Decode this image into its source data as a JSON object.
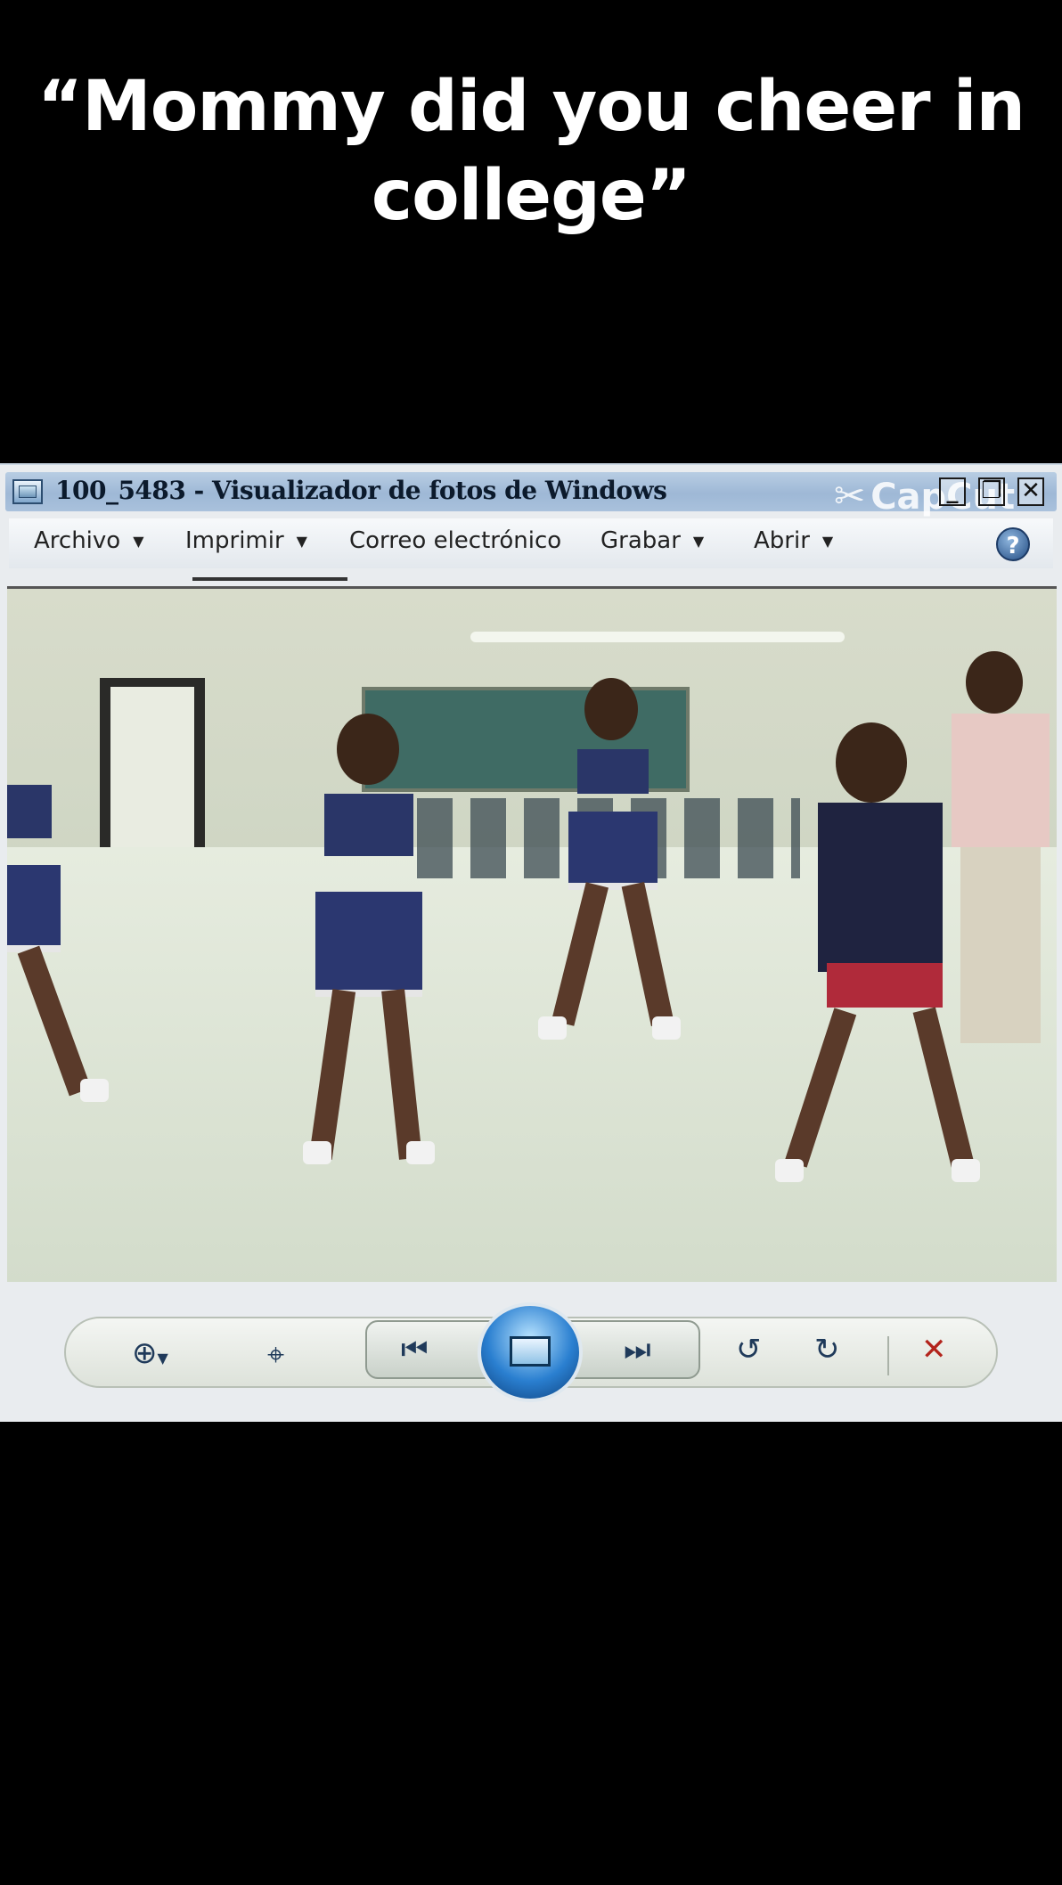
{
  "caption": {
    "line1": "“Mommy did you cheer in",
    "line2": "college”"
  },
  "window": {
    "title": "100_5483 - Visualizador de fotos de Windows",
    "watermark": "CapCut",
    "menu": [
      {
        "label": "Archivo",
        "has_dropdown": true
      },
      {
        "label": "Imprimir",
        "has_dropdown": true
      },
      {
        "label": "Correo electrónico",
        "has_dropdown": false
      },
      {
        "label": "Grabar",
        "has_dropdown": true
      },
      {
        "label": "Abrir",
        "has_dropdown": true
      }
    ],
    "help_label": "?",
    "photo_icons": [
      "zoom-icon",
      "actual-size-icon",
      "previous-icon",
      "slideshow-icon",
      "next-icon",
      "rotate-left-icon",
      "rotate-right-icon",
      "delete-icon"
    ]
  },
  "colors": {
    "background": "#000000",
    "caption_text": "#ffffff",
    "titlebar": "#a9c1dc",
    "delete_icon": "#b3241c",
    "control_icon": "#1f3a5a"
  }
}
